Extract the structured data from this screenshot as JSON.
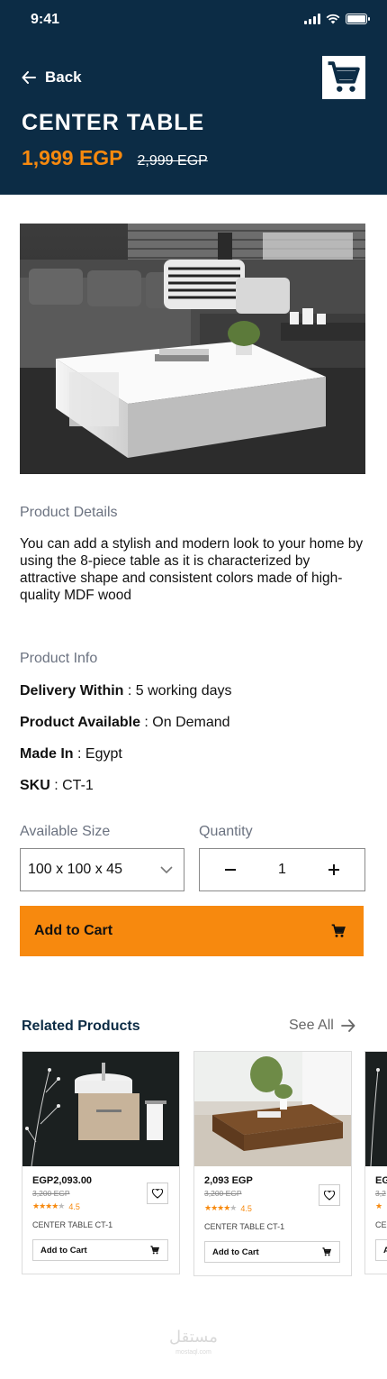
{
  "status_bar": {
    "time": "9:41"
  },
  "header": {
    "back_label": "Back",
    "title": "CENTER TABLE",
    "price": "1,999 EGP",
    "old_price": "2,999 EGP"
  },
  "details": {
    "label": "Product Details",
    "text": "You can add a stylish and modern look to your home by using the 8-piece table as it is characterized by attractive shape and consistent colors made of high-quality MDF wood"
  },
  "info": {
    "label": "Product Info",
    "items": [
      {
        "key": "Delivery Within",
        "value": " : 5 working days"
      },
      {
        "key": "Product Available",
        "value": " : On Demand"
      },
      {
        "key": "Made In",
        "value": " : Egypt"
      },
      {
        "key": "SKU",
        "value": " : CT-1"
      }
    ]
  },
  "options": {
    "size_label": "Available Size",
    "size_value": "100 x 100 x 45",
    "qty_label": "Quantity",
    "qty_value": "1"
  },
  "add_to_cart_label": "Add to Cart",
  "related": {
    "title": "Related Products",
    "see_all": "See All",
    "items": [
      {
        "price": "EGP2,093.00",
        "old_price": "3,200 EGP",
        "rating": "4.5",
        "name": "CENTER TABLE CT-1",
        "add_label": "Add to Cart"
      },
      {
        "price": "2,093 EGP",
        "old_price": "3,200 EGP",
        "rating": "4.5",
        "name": "CENTER TABLE CT-1",
        "add_label": "Add to Cart"
      },
      {
        "price": "EG",
        "old_price": "3,2",
        "rating": "",
        "name": "CE",
        "add_label": "A"
      }
    ]
  },
  "colors": {
    "header": "#0c2c45",
    "accent": "#f7890e"
  },
  "watermark": {
    "main": "مستقل",
    "sub": "mostaql.com"
  }
}
